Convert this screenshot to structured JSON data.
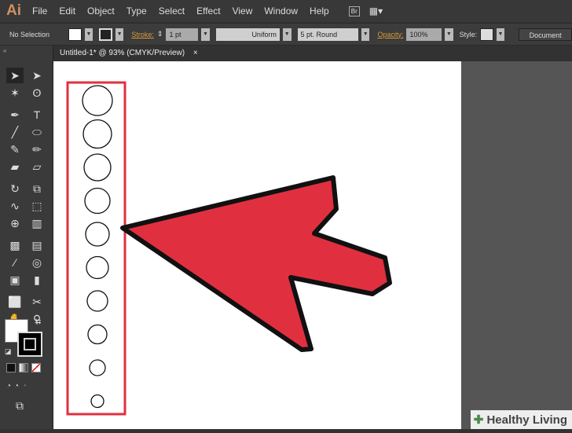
{
  "app": {
    "logo": "Ai"
  },
  "menu": [
    "File",
    "Edit",
    "Object",
    "Type",
    "Select",
    "Effect",
    "View",
    "Window",
    "Help"
  ],
  "menu_buttons": {
    "bridge": "Br",
    "arrange": "▦▾"
  },
  "control": {
    "selection": "No Selection",
    "stroke_label": "Stroke:",
    "stroke_value": "1 pt",
    "profile": "Uniform",
    "brush": "5 pt. Round",
    "opacity_label": "Opacity:",
    "opacity_value": "100%",
    "style_label": "Style:",
    "document_button": "Document"
  },
  "tab": {
    "title": "Untitled-1* @ 93% (CMYK/Preview)",
    "close": "×"
  },
  "tools": [
    {
      "name": "selection-tool",
      "g": "➤"
    },
    {
      "name": "direct-selection-tool",
      "g": "➤"
    },
    {
      "name": "magic-wand-tool",
      "g": "✶"
    },
    {
      "name": "lasso-tool",
      "g": "ʘ"
    },
    {
      "name": "pen-tool",
      "g": "✒"
    },
    {
      "name": "type-tool",
      "g": "T"
    },
    {
      "name": "line-tool",
      "g": "╱"
    },
    {
      "name": "ellipse-tool",
      "g": "⬭"
    },
    {
      "name": "paintbrush-tool",
      "g": "✎"
    },
    {
      "name": "pencil-tool",
      "g": "✏"
    },
    {
      "name": "blob-brush-tool",
      "g": "▰"
    },
    {
      "name": "eraser-tool",
      "g": "▱"
    },
    {
      "name": "rotate-tool",
      "g": "↻"
    },
    {
      "name": "scale-tool",
      "g": "⧉"
    },
    {
      "name": "warp-tool",
      "g": "∿"
    },
    {
      "name": "free-transform-tool",
      "g": "⬚"
    },
    {
      "name": "shape-builder-tool",
      "g": "⊕"
    },
    {
      "name": "perspective-grid-tool",
      "g": "▥"
    },
    {
      "name": "mesh-tool",
      "g": "▩"
    },
    {
      "name": "gradient-tool",
      "g": "▤"
    },
    {
      "name": "eyedropper-tool",
      "g": "⁄"
    },
    {
      "name": "blend-tool",
      "g": "◎"
    },
    {
      "name": "symbol-sprayer-tool",
      "g": "▣"
    },
    {
      "name": "column-graph-tool",
      "g": "▮"
    },
    {
      "name": "artboard-tool",
      "g": "⬜"
    },
    {
      "name": "slice-tool",
      "g": "✂"
    },
    {
      "name": "hand-tool",
      "g": "✋"
    },
    {
      "name": "zoom-tool",
      "g": "⚲"
    }
  ],
  "colors": {
    "annotation": "#e0303f",
    "arrow_fill": "#e03040",
    "arrow_stroke": "#111111"
  },
  "circles": [
    19,
    18,
    17,
    16,
    15,
    14,
    13,
    12,
    10,
    8
  ],
  "watermark": {
    "prefix": "✚",
    "brand": "Healthy Living"
  }
}
